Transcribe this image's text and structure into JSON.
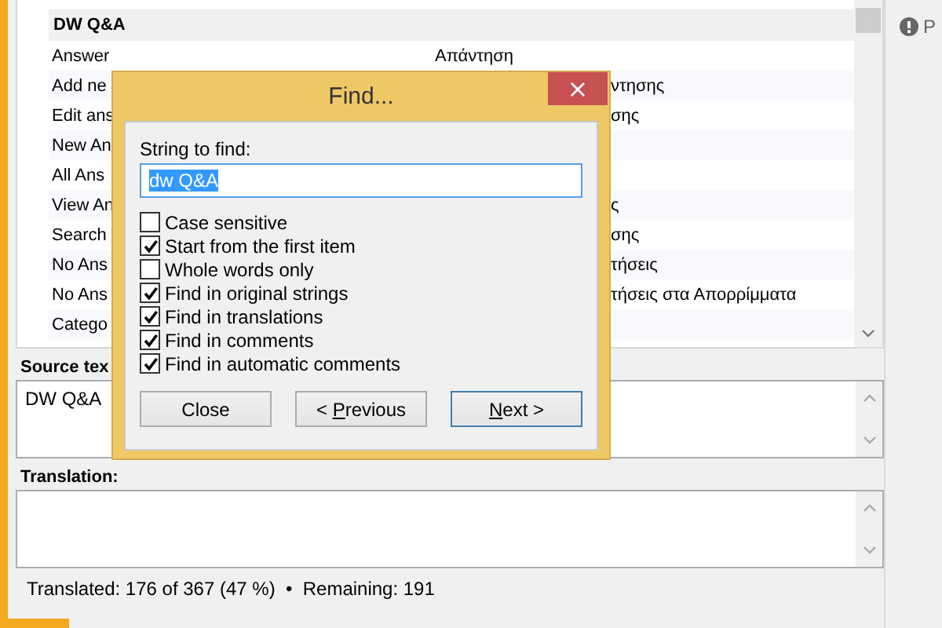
{
  "list": {
    "group": "DW Q&A",
    "rows": [
      {
        "source": "Answer",
        "translation": "Απάντηση"
      },
      {
        "source": "Add ne",
        "translation": "ντησης"
      },
      {
        "source": "Edit ans",
        "translation": "σης"
      },
      {
        "source": "New An"
      },
      {
        "source": "All Ans"
      },
      {
        "source": "View An",
        "translation": "ς"
      },
      {
        "source": "Search",
        "translation": "σης"
      },
      {
        "source": "No Ans",
        "translation": "τήσεις"
      },
      {
        "source": "No Ans",
        "translation": "τήσεις στα Απορρίμματα"
      },
      {
        "source": "Catego"
      }
    ]
  },
  "source_label": "Source tex",
  "source_text": "DW Q&A",
  "translation_label": "Translation:",
  "status_bar": "Translated: 176 of 367 (47 %)  •  Remaining: 191",
  "side_panel": {
    "item": "P"
  },
  "find_dialog": {
    "title": "Find...",
    "close": "×",
    "field_label": "String to find:",
    "value": "dw Q&A",
    "options": [
      {
        "label": "Case sensitive",
        "checked": false
      },
      {
        "label": "Start from the first item",
        "checked": true
      },
      {
        "label": "Whole words only",
        "checked": false
      },
      {
        "label": "Find in original strings",
        "checked": true
      },
      {
        "label": "Find in translations",
        "checked": true
      },
      {
        "label": "Find in comments",
        "checked": true
      },
      {
        "label": "Find in automatic comments",
        "checked": true
      }
    ],
    "buttons": [
      {
        "text_before": "Close",
        "default": false
      },
      {
        "text_before": "< ",
        "access_key": "P",
        "text_after": "revious",
        "default": false
      },
      {
        "access_key": "N",
        "text_after": "ext >",
        "default": true
      }
    ]
  }
}
